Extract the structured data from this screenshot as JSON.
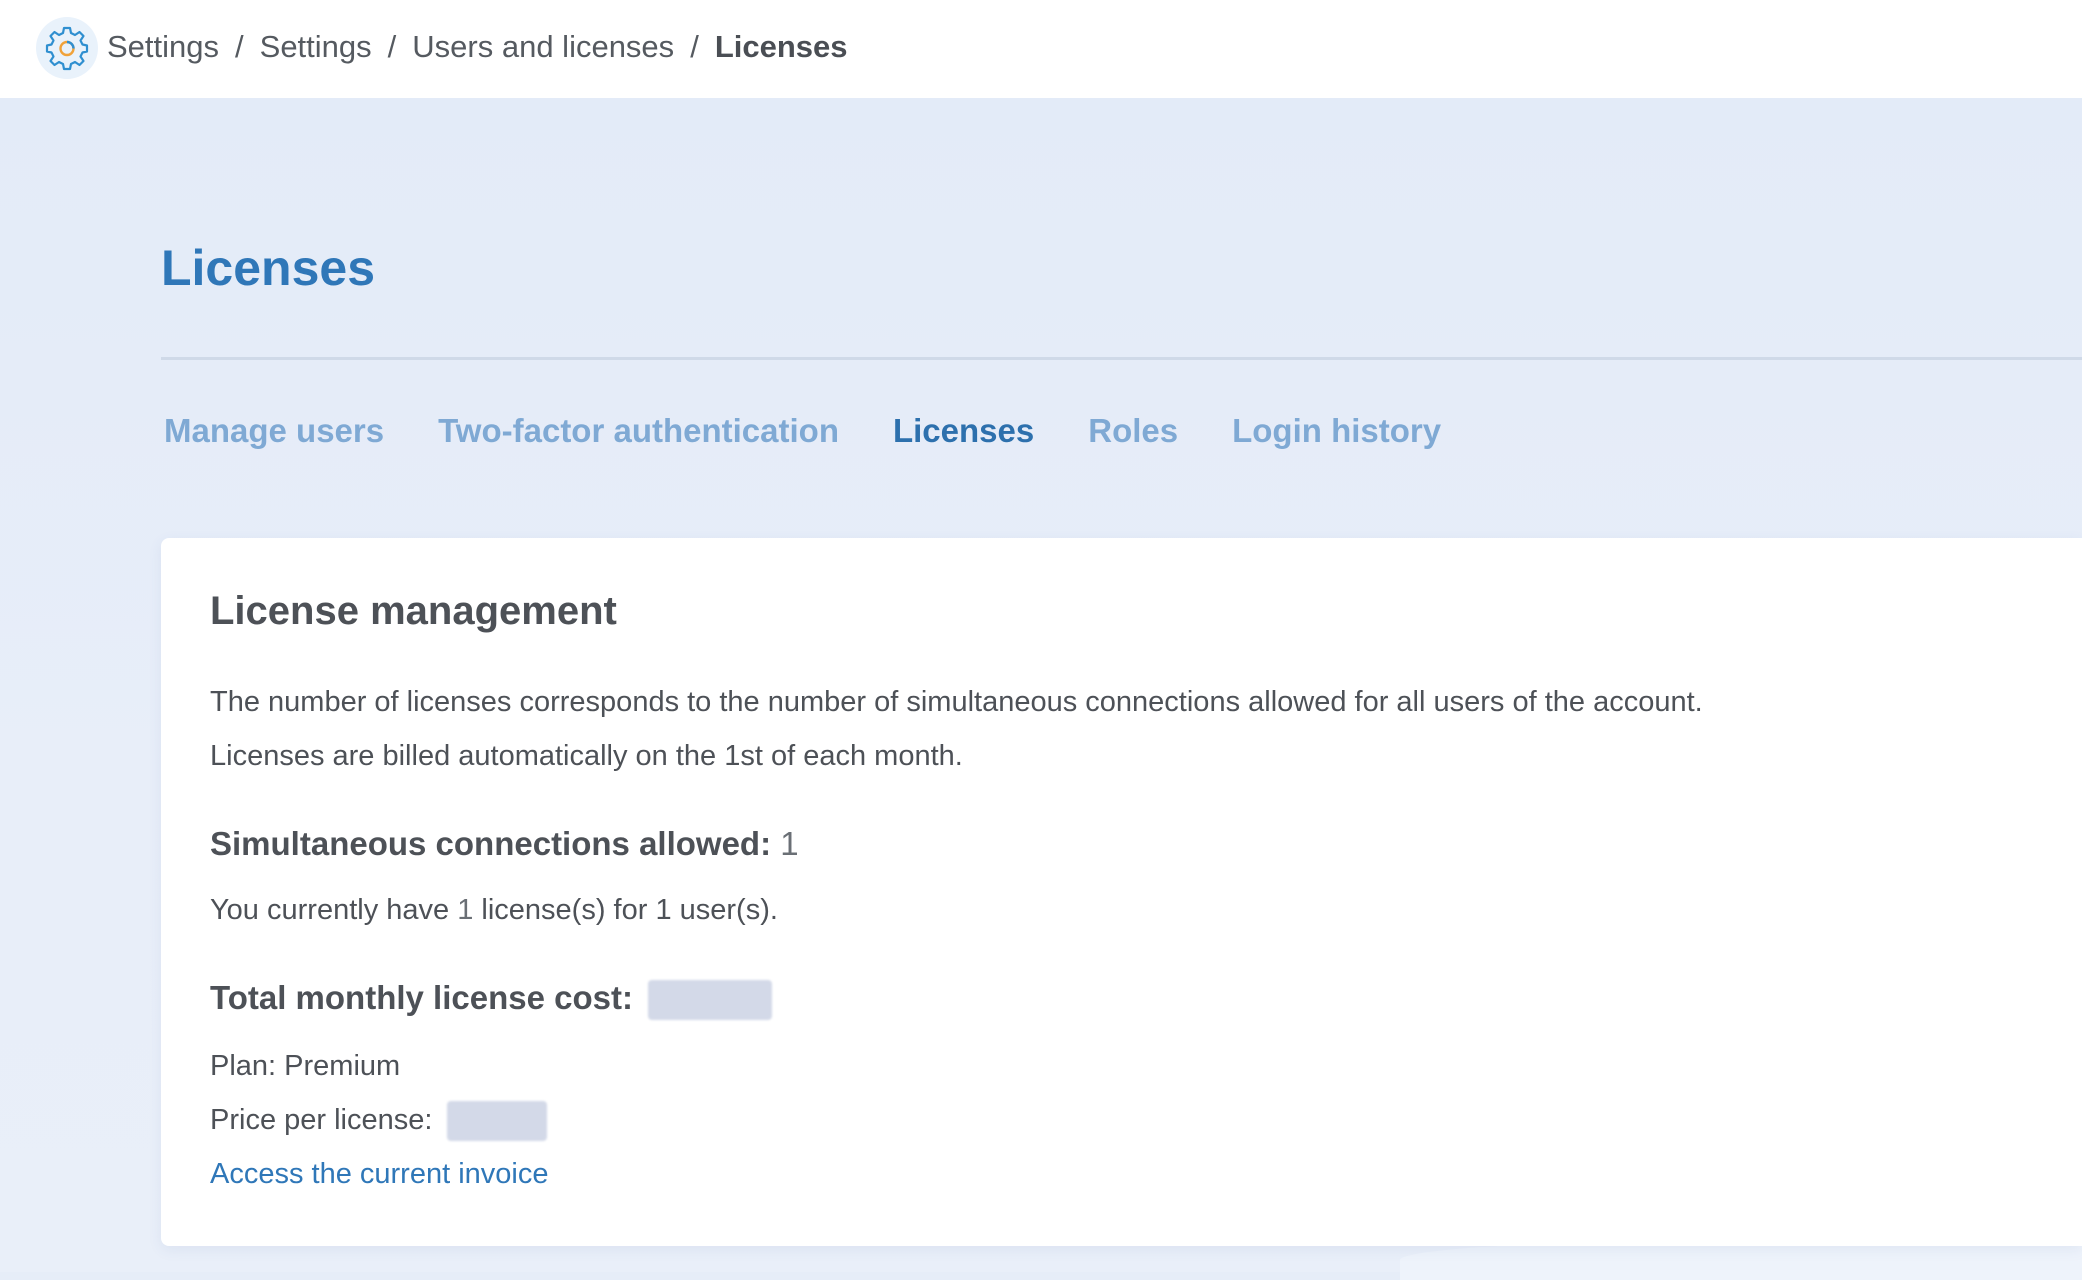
{
  "breadcrumb": {
    "items": [
      "Settings",
      "Settings",
      "Users and licenses"
    ],
    "current": "Licenses",
    "separator": "/"
  },
  "page": {
    "title": "Licenses"
  },
  "tabs": [
    {
      "label": "Manage users",
      "active": false
    },
    {
      "label": "Two-factor authentication",
      "active": false
    },
    {
      "label": "Licenses",
      "active": true
    },
    {
      "label": "Roles",
      "active": false
    },
    {
      "label": "Login history",
      "active": false
    }
  ],
  "card": {
    "title": "License management",
    "description_line1": "The number of licenses corresponds to the number of simultaneous connections allowed for all users of the account.",
    "description_line2": "Licenses are billed automatically on the 1st of each month.",
    "connections_label": "Simultaneous connections allowed:",
    "connections_value": "1",
    "licenses_prefix": "You currently have ",
    "licenses_count": "1",
    "licenses_suffix": " license(s) for 1 user(s).",
    "cost_label": "Total monthly license cost:",
    "plan_text": "Plan: Premium",
    "price_label": "Price per license:",
    "invoice_link": "Access the current invoice"
  },
  "icons": {
    "settings": "gear-icon"
  },
  "colors": {
    "accent": "#2f77b8",
    "tab_inactive": "#7fa9d4",
    "background": "#e6edf8"
  }
}
